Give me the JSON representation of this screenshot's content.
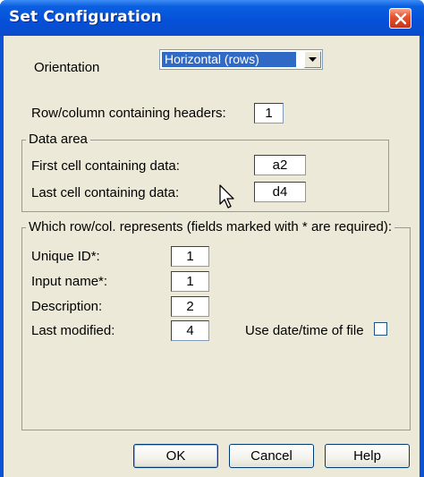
{
  "dialog": {
    "title": "Set Configuration"
  },
  "orientation": {
    "label": "Orientation",
    "selected": "Horizontal (rows)"
  },
  "headers_row": {
    "label": "Row/column containing headers:",
    "value": "1"
  },
  "data_area": {
    "legend": "Data area",
    "first_cell_label": "First cell containing data:",
    "first_cell_value": "a2",
    "last_cell_label": "Last cell containing data:",
    "last_cell_value": "d4"
  },
  "mapping": {
    "legend": "Which row/col. represents (fields marked with * are required):",
    "unique_id_label": "Unique ID*:",
    "unique_id_value": "1",
    "input_name_label": "Input name*:",
    "input_name_value": "1",
    "description_label": "Description:",
    "description_value": "2",
    "last_modified_label": "Last modified:",
    "last_modified_value": "4",
    "use_date_label": "Use date/time of file",
    "use_date_checked": false
  },
  "buttons": {
    "ok": "OK",
    "cancel": "Cancel",
    "help": "Help"
  },
  "colors": {
    "titlebar": "#0550d8",
    "dialog_face": "#ece9d8",
    "selection": "#316ac5",
    "close_button": "#e6552d"
  }
}
